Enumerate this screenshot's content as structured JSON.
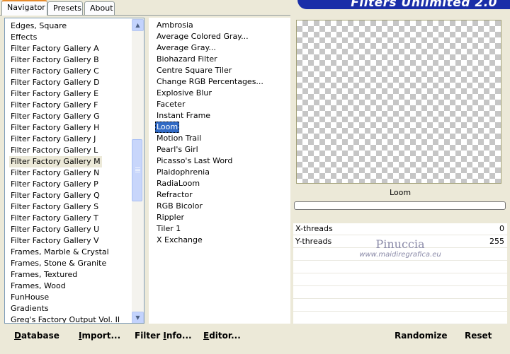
{
  "banner": {
    "title": "Filters Unlimited 2.0"
  },
  "tabs": [
    {
      "label": "Navigator",
      "active": true
    },
    {
      "label": "Presets",
      "active": false
    },
    {
      "label": "About",
      "active": false
    }
  ],
  "categories": [
    "Edges, Square",
    "Effects",
    "Filter Factory Gallery A",
    "Filter Factory Gallery B",
    "Filter Factory Gallery C",
    "Filter Factory Gallery D",
    "Filter Factory Gallery E",
    "Filter Factory Gallery F",
    "Filter Factory Gallery G",
    "Filter Factory Gallery H",
    "Filter Factory Gallery J",
    "Filter Factory Gallery L",
    "Filter Factory Gallery M",
    "Filter Factory Gallery N",
    "Filter Factory Gallery P",
    "Filter Factory Gallery Q",
    "Filter Factory Gallery S",
    "Filter Factory Gallery T",
    "Filter Factory Gallery U",
    "Filter Factory Gallery V",
    "Frames, Marble & Crystal",
    "Frames, Stone & Granite",
    "Frames, Textured",
    "Frames, Wood",
    "FunHouse",
    "Gradients",
    "Greg's Factory Output Vol. II"
  ],
  "selected_category": "Filter Factory Gallery M",
  "filters": [
    "Ambrosia",
    "Average Colored Gray...",
    "Average Gray...",
    "Biohazard Filter",
    "Centre Square Tiler",
    "Change RGB Percentages...",
    "Explosive Blur",
    "Faceter",
    "Instant Frame",
    "Loom",
    "Motion Trail",
    "Pearl's Girl",
    "Picasso's Last Word",
    "Plaidophrenia",
    "RadiaLoom",
    "Refractor",
    "RGB Bicolor",
    "Rippler",
    "Tiler 1",
    "X Exchange"
  ],
  "selected_filter": "Loom",
  "preview": {
    "filter_name": "Loom"
  },
  "params": [
    {
      "label": "X-threads",
      "value": "0"
    },
    {
      "label": "Y-threads",
      "value": "255"
    }
  ],
  "watermark": {
    "line1": "Pinuccia",
    "line2": "www.maidiregrafica.eu"
  },
  "buttons": {
    "database": {
      "label": "Database",
      "underline_index": 0
    },
    "import": {
      "label": "Import...",
      "underline_index": 0
    },
    "filter_info": {
      "label": "Filter Info...",
      "underline_index": 7
    },
    "editor": {
      "label": "Editor...",
      "underline_index": 0
    },
    "randomize": {
      "label": "Randomize"
    },
    "reset": {
      "label": "Reset"
    }
  },
  "colors": {
    "accent": "#316ac5",
    "banner": "#1a2ea8",
    "tab_highlight": "#e68b2c"
  },
  "icons": {
    "scroll_up": "up-arrow",
    "scroll_down": "down-arrow"
  }
}
